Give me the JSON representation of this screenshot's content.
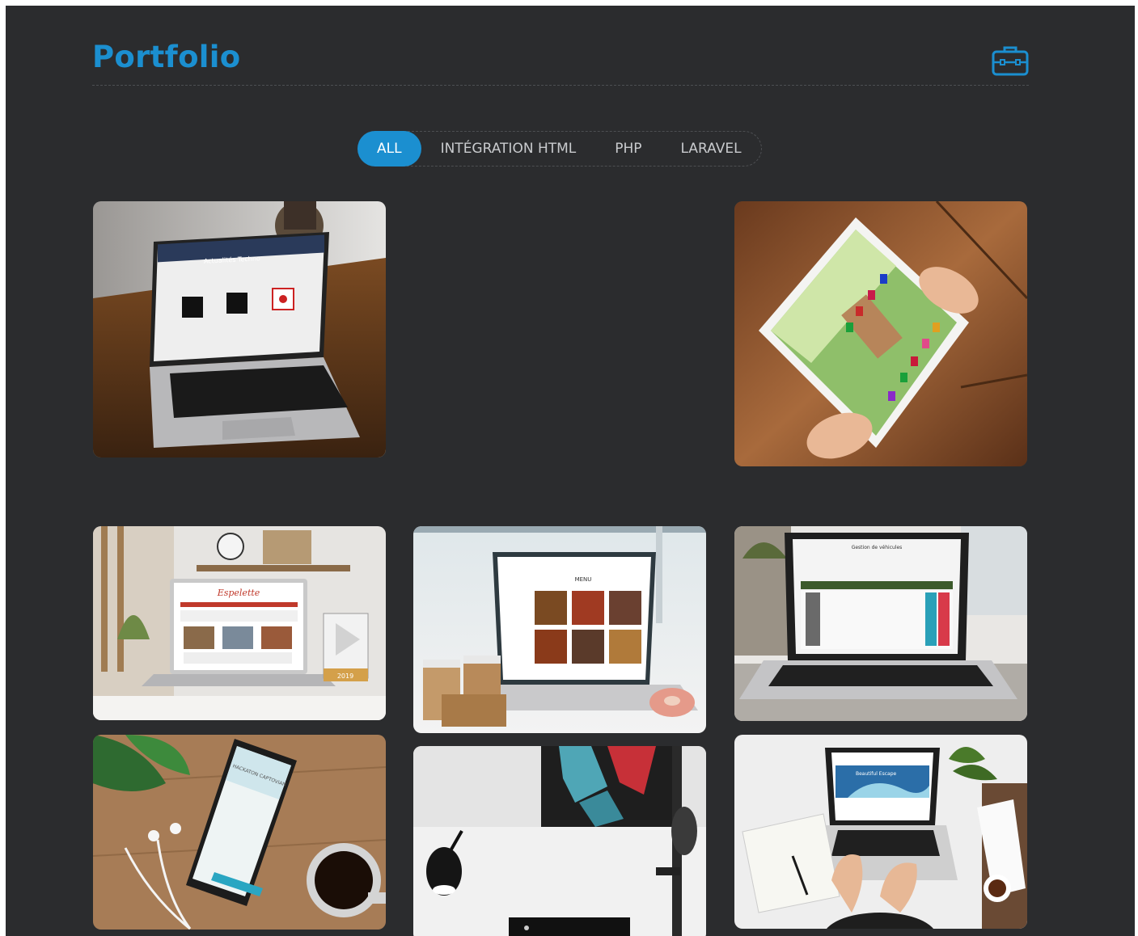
{
  "header": {
    "title": "Portfolio",
    "icon": "briefcase-icon",
    "accent": "#1b8fd0"
  },
  "filters": [
    {
      "label": "ALL",
      "active": true
    },
    {
      "label": "INTÉGRATION HTML",
      "active": false
    },
    {
      "label": "PHP",
      "active": false
    },
    {
      "label": "LARAVEL",
      "active": false
    }
  ],
  "screens": {
    "actualites_title": "Actualités Techno",
    "restaurant_logo": "Espelette",
    "restaurant_menu_title": "MENU",
    "restaurant_year": "2019",
    "vote_title": "Gestion de véhicules",
    "phone_title": "HACKATON CAPTOVIAN",
    "wave_title": "Beautiful Escape"
  },
  "portfolio": {
    "items": [
      {
        "name": "laptop-techno-news",
        "category": "php"
      },
      {
        "name": "tablet-kids-game",
        "category": "integration-html"
      },
      {
        "name": "laptop-restaurant-site",
        "category": "integration-html"
      },
      {
        "name": "laptop-food-menu",
        "category": "integration-html"
      },
      {
        "name": "laptop-vehicle-table",
        "category": "laravel"
      },
      {
        "name": "phone-hackathon",
        "category": "php"
      },
      {
        "name": "studio-microphone",
        "category": "integration-html"
      },
      {
        "name": "laptop-surf-site",
        "category": "integration-html"
      }
    ]
  }
}
